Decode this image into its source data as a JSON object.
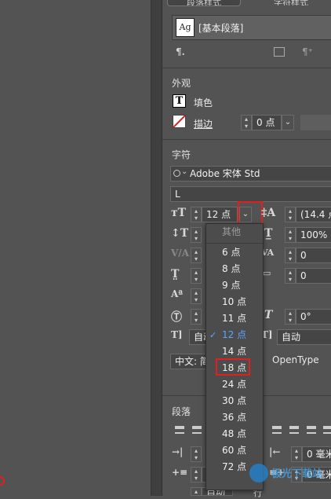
{
  "tabs": [
    "段落样式",
    "字符样式"
  ],
  "paragraph_style": {
    "swatch": "Ag",
    "name": "[基本段落]"
  },
  "appearance": {
    "title": "外观",
    "fill_label": "填色",
    "stroke_label": "描边",
    "stroke_value": "0 点"
  },
  "character": {
    "title": "字符",
    "font_family": "Adobe 宋体 Std",
    "font_style": "L",
    "font_size": "12 点",
    "leading": "(14.4 点",
    "horizontal_scale": "100%",
    "tracking": "0",
    "kerning": "0",
    "skew": "0°",
    "auto_label_left": "自动",
    "auto_label_right": "自动",
    "language_prefix": "中文: 简",
    "opentype_button": "OpenType"
  },
  "size_menu": {
    "other": "其他",
    "items": [
      "6 点",
      "8 点",
      "9 点",
      "10 点",
      "11 点",
      "12 点",
      "14 点",
      "18 点",
      "24 点",
      "30 点",
      "36 点",
      "48 点",
      "60 点",
      "72 点"
    ],
    "selected": "12 点",
    "highlighted": "18 点"
  },
  "paragraph": {
    "title": "段落",
    "indent_right": "0 毫米",
    "space_right": "0 毫米",
    "space_left": "0 毫",
    "auto_bottom": "自动",
    "row_label": "行"
  },
  "watermark": "极光下载站",
  "colors": {
    "highlight": "#e02020",
    "selected_text": "#58a6ff",
    "panel_bg": "#535353"
  }
}
